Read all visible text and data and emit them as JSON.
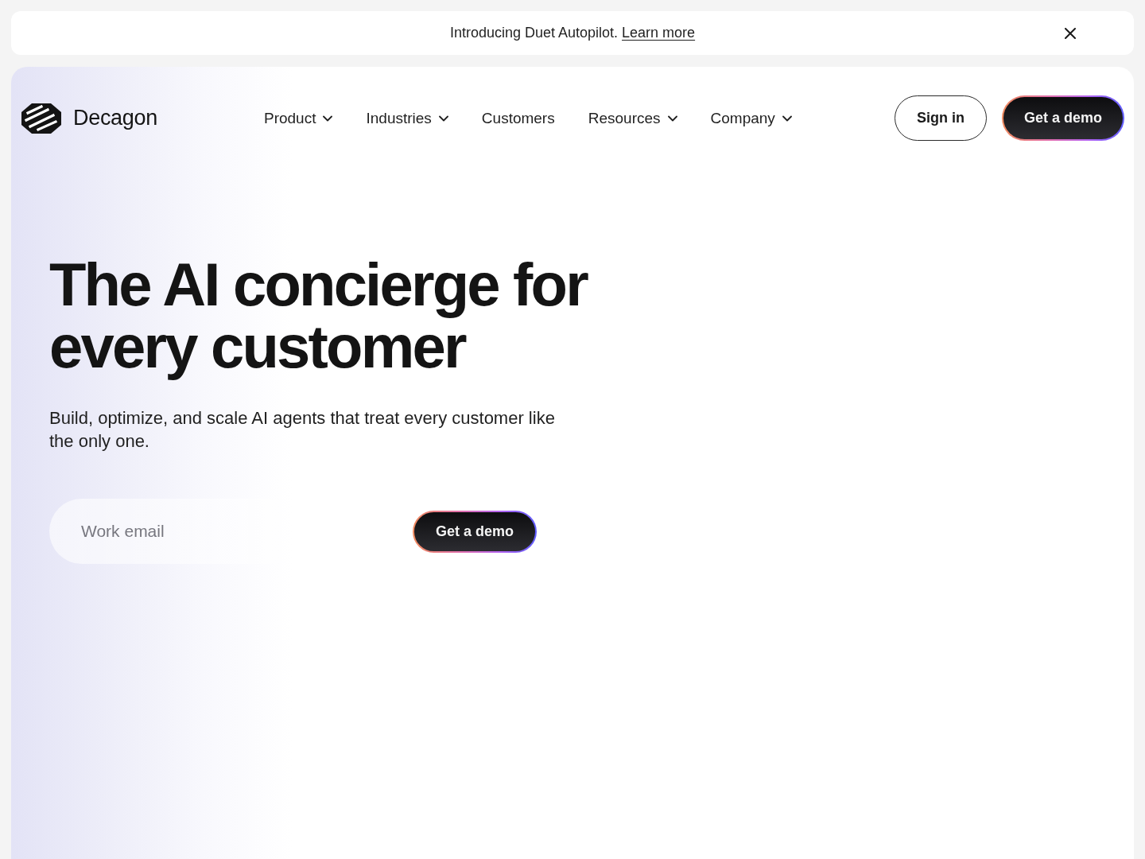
{
  "announcement": {
    "text": "Introducing Duet Autopilot.",
    "link": "Learn more"
  },
  "header": {
    "brand": "Decagon",
    "nav": [
      {
        "label": "Product",
        "kind": "dropdown"
      },
      {
        "label": "Industries",
        "kind": "dropdown"
      },
      {
        "label": "Customers",
        "kind": "link"
      },
      {
        "label": "Resources",
        "kind": "dropdown"
      },
      {
        "label": "Company",
        "kind": "dropdown"
      }
    ],
    "actions": [
      {
        "label": "Sign in",
        "kind": "outline"
      },
      {
        "label": "Get a demo",
        "kind": "primary"
      }
    ]
  },
  "hero": {
    "title": "The AI concierge for every customer",
    "subtitle": "Build, optimize, and scale AI agents that treat every customer like the only one.",
    "email_field": {
      "placeholder": "Work email"
    },
    "button": "Get a demo"
  }
}
